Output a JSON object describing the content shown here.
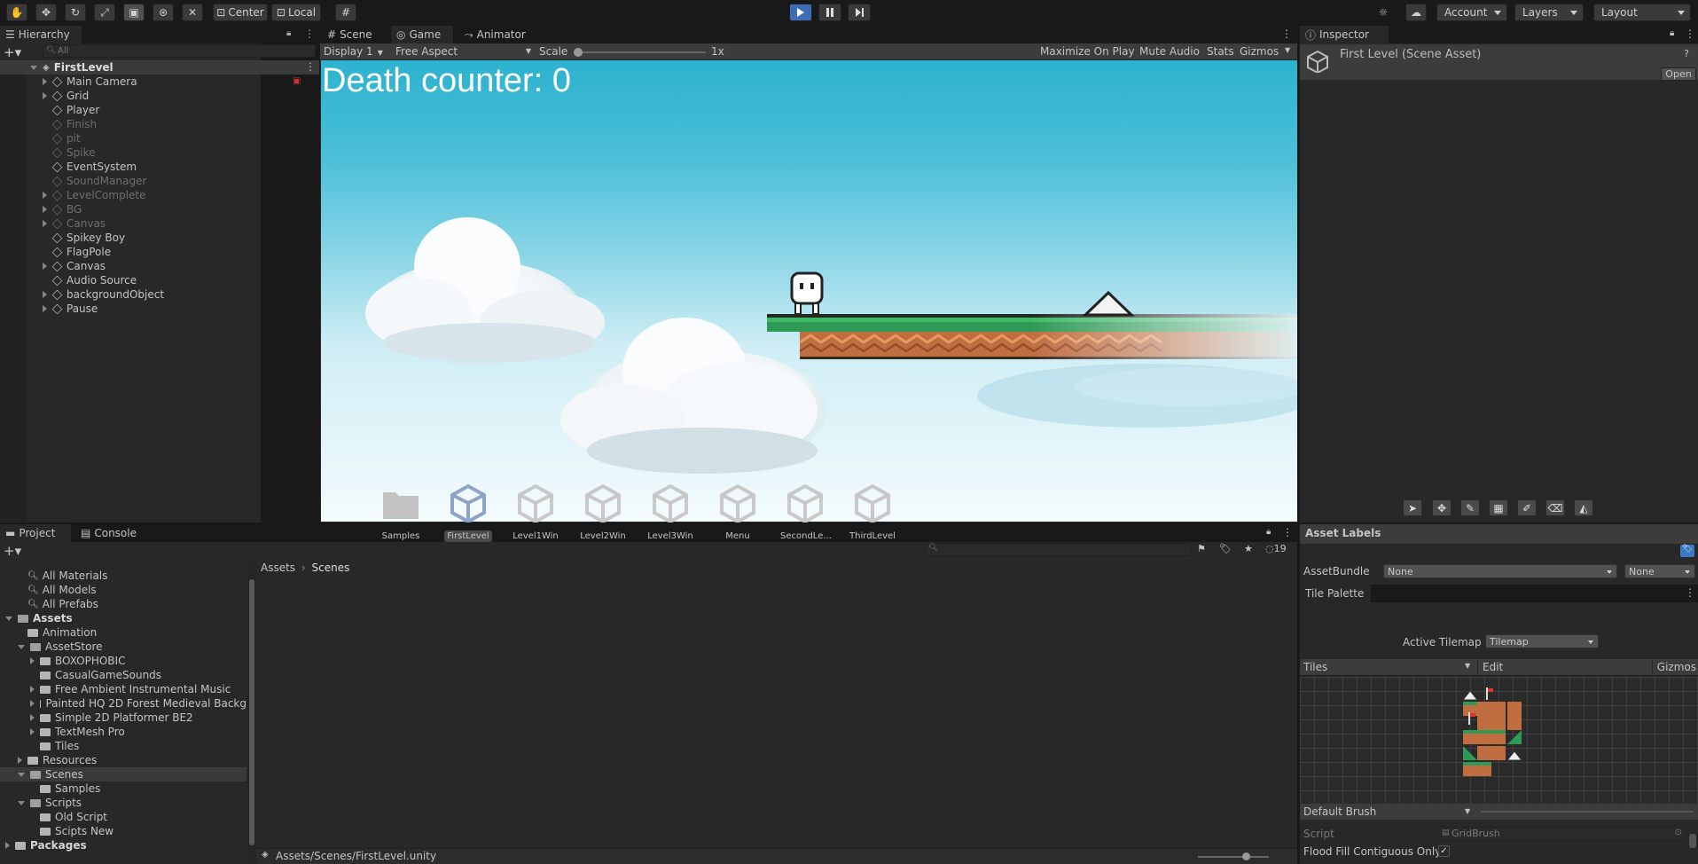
{
  "toolbar": {
    "pivot": "Center",
    "space": "Local",
    "account": "Account",
    "layers": "Layers",
    "layout": "Layout",
    "play_icon": "play-icon",
    "pause_icon": "pause-icon",
    "step_icon": "step-icon"
  },
  "hierarchy": {
    "tab": "Hierarchy",
    "search_placeholder": "All",
    "scene": "FirstLevel",
    "items": [
      {
        "label": "Main Camera",
        "expandable": true,
        "active": true
      },
      {
        "label": "Grid",
        "expandable": true,
        "active": true
      },
      {
        "label": "Player",
        "expandable": false,
        "active": true
      },
      {
        "label": "Finish",
        "expandable": false,
        "active": false
      },
      {
        "label": "pit",
        "expandable": false,
        "active": false
      },
      {
        "label": "Spike",
        "expandable": false,
        "active": false
      },
      {
        "label": "EventSystem",
        "expandable": false,
        "active": true
      },
      {
        "label": "SoundManager",
        "expandable": false,
        "active": false
      },
      {
        "label": "LevelComplete",
        "expandable": true,
        "active": false
      },
      {
        "label": "BG",
        "expandable": true,
        "active": false
      },
      {
        "label": "Canvas",
        "expandable": true,
        "active": false
      },
      {
        "label": "Spikey Boy",
        "expandable": false,
        "active": true
      },
      {
        "label": "FlagPole",
        "expandable": false,
        "active": true
      },
      {
        "label": "Canvas",
        "expandable": true,
        "active": true
      },
      {
        "label": "Audio Source",
        "expandable": false,
        "active": true
      },
      {
        "label": "backgroundObject",
        "expandable": true,
        "active": true
      },
      {
        "label": "Pause",
        "expandable": true,
        "active": true
      }
    ]
  },
  "center": {
    "tabs": [
      "Scene",
      "Game",
      "Animator"
    ],
    "display": "Display 1",
    "aspect": "Free Aspect",
    "scale_label": "Scale",
    "scale_value": "1x",
    "maximize": "Maximize On Play",
    "mute": "Mute Audio",
    "stats": "Stats",
    "gizmos": "Gizmos",
    "death_counter": "Death counter: 0"
  },
  "inspector": {
    "tab": "Inspector",
    "title": "First Level (Scene Asset)",
    "open": "Open"
  },
  "project": {
    "tabs": [
      "Project",
      "Console"
    ],
    "search_placeholder": "",
    "hidden_count": "19",
    "breadcrumb": [
      "Assets",
      "Scenes"
    ],
    "path": "Assets/Scenes/FirstLevel.unity",
    "tree": [
      {
        "label": "All Materials",
        "level": 1,
        "kind": "search"
      },
      {
        "label": "All Models",
        "level": 1,
        "kind": "search"
      },
      {
        "label": "All Prefabs",
        "level": 1,
        "kind": "search"
      },
      {
        "label": "Assets",
        "level": 0,
        "kind": "folder",
        "open": true,
        "bold": true
      },
      {
        "label": "Animation",
        "level": 1,
        "kind": "folder"
      },
      {
        "label": "AssetStore",
        "level": 1,
        "kind": "folder",
        "open": true
      },
      {
        "label": "BOXOPHOBIC",
        "level": 2,
        "kind": "folder",
        "arrow": true
      },
      {
        "label": "CasualGameSounds",
        "level": 2,
        "kind": "folder"
      },
      {
        "label": "Free Ambient Instrumental Music",
        "level": 2,
        "kind": "folder",
        "arrow": true
      },
      {
        "label": "Painted HQ 2D Forest Medieval Backg",
        "level": 2,
        "kind": "folder",
        "arrow": true
      },
      {
        "label": "Simple 2D Platformer BE2",
        "level": 2,
        "kind": "folder",
        "arrow": true
      },
      {
        "label": "TextMesh Pro",
        "level": 2,
        "kind": "folder",
        "arrow": true
      },
      {
        "label": "Tiles",
        "level": 2,
        "kind": "folder"
      },
      {
        "label": "Resources",
        "level": 1,
        "kind": "folder",
        "arrow": true
      },
      {
        "label": "Scenes",
        "level": 1,
        "kind": "folder",
        "open": true,
        "selected": true
      },
      {
        "label": "Samples",
        "level": 2,
        "kind": "folder"
      },
      {
        "label": "Scripts",
        "level": 1,
        "kind": "folder",
        "open": true
      },
      {
        "label": "Old Script",
        "level": 2,
        "kind": "folder"
      },
      {
        "label": "Scipts New",
        "level": 2,
        "kind": "folder"
      },
      {
        "label": "Packages",
        "level": 0,
        "kind": "folder",
        "arrow": true,
        "bold": true
      }
    ],
    "assets": [
      {
        "label": "Samples",
        "kind": "folder"
      },
      {
        "label": "FirstLevel",
        "kind": "scene",
        "selected": true
      },
      {
        "label": "Level1Win",
        "kind": "scene"
      },
      {
        "label": "Level2Win",
        "kind": "scene"
      },
      {
        "label": "Level3Win",
        "kind": "scene"
      },
      {
        "label": "Menu",
        "kind": "scene"
      },
      {
        "label": "SecondLe...",
        "kind": "scene"
      },
      {
        "label": "ThirdLevel",
        "kind": "scene"
      }
    ]
  },
  "asset_labels": {
    "title": "Asset Labels",
    "bundle_label": "AssetBundle",
    "bundle_value": "None",
    "variant_value": "None"
  },
  "tile_palette": {
    "tab": "Tile Palette",
    "active_tilemap_label": "Active Tilemap",
    "active_tilemap": "Tilemap",
    "tiles": "Tiles",
    "edit": "Edit",
    "gizmos": "Gizmos",
    "brush": "Default Brush",
    "script_label": "Script",
    "script_value": "GridBrush",
    "flood_label": "Flood Fill Contiguous Only"
  }
}
